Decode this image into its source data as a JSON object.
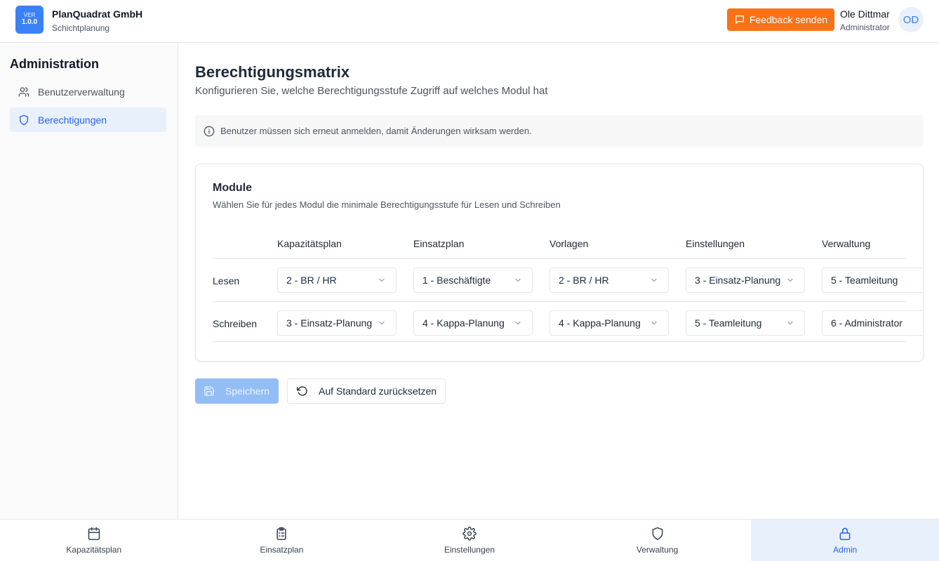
{
  "header": {
    "logo": {
      "ver": "VER",
      "version": "1.0.0"
    },
    "company_name": "PlanQuadrat GmbH",
    "company_sub": "Schichtplanung",
    "feedback_label": "Feedback senden",
    "user_name": "Ole Dittmar",
    "user_role": "Administrator",
    "avatar_initials": "OD"
  },
  "sidebar": {
    "title": "Administration",
    "items": [
      {
        "label": "Benutzerverwaltung",
        "icon": "users-icon",
        "active": false
      },
      {
        "label": "Berechtigungen",
        "icon": "shield-icon",
        "active": true
      }
    ]
  },
  "main": {
    "title": "Berechtigungsmatrix",
    "subtitle": "Konfigurieren Sie, welche Berechtigungsstufe Zugriff auf welches Modul hat",
    "info": "Benutzer müssen sich erneut anmelden, damit Änderungen wirksam werden.",
    "card": {
      "title": "Module",
      "subtitle": "Wählen Sie für jedes Modul die minimale Berechtigungsstufe für Lesen und Schreiben",
      "columns": [
        "Kapazitätsplan",
        "Einsatzplan",
        "Vorlagen",
        "Einstellungen",
        "Verwaltung"
      ],
      "rows": [
        {
          "label": "Lesen",
          "values": [
            "2 - BR / HR",
            "1 - Beschäftigte",
            "2 - BR / HR",
            "3 - Einsatz-Planung",
            "5 - Teamleitung"
          ]
        },
        {
          "label": "Schreiben",
          "values": [
            "3 - Einsatz-Planung",
            "4 - Kappa-Planung",
            "4 - Kappa-Planung",
            "5 - Teamleitung",
            "6 - Administrator"
          ]
        }
      ]
    },
    "save_label": "Speichern",
    "reset_label": "Auf Standard zurücksetzen"
  },
  "bottom_nav": [
    {
      "label": "Kapazitätsplan",
      "icon": "calendar-icon",
      "active": false
    },
    {
      "label": "Einsatzplan",
      "icon": "clipboard-icon",
      "active": false
    },
    {
      "label": "Einstellungen",
      "icon": "gear-icon",
      "active": false
    },
    {
      "label": "Verwaltung",
      "icon": "shield-icon",
      "active": false
    },
    {
      "label": "Admin",
      "icon": "lock-icon",
      "active": true
    }
  ],
  "colors": {
    "accent": "#2563eb",
    "feedback": "#f97316",
    "active_bg": "#e8f0fb"
  }
}
